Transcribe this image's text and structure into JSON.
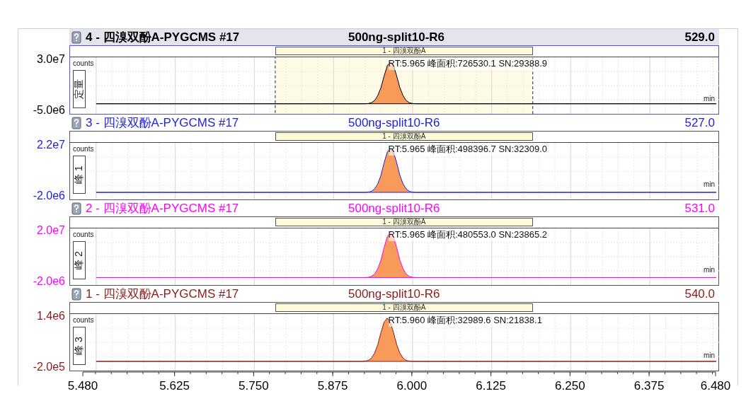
{
  "panels": [
    {
      "title": "4 - 四溴双酚A-PYGCMS #17",
      "sample": "500ng-split10-R6",
      "mass": "529.0",
      "color": "#000000",
      "selected": true,
      "bar_label": "1 - 四溴双酚A",
      "y_unit": "counts",
      "side_label": "定量",
      "peak_label": "RT:5.965 峰面积:726530.1 SN:29388.9",
      "x_unit": "min",
      "chart_data": {
        "type": "area",
        "xlim": [
          5.48,
          6.48
        ],
        "ylim": [
          -5000000,
          30000000
        ],
        "yticks": [
          {
            "value": 30000000,
            "label": "3.0e7"
          },
          {
            "value": -5000000,
            "label": "-5.0e6"
          }
        ],
        "grid": true,
        "x": [
          5.5,
          5.925,
          5.93,
          5.935,
          5.94,
          5.945,
          5.95,
          5.955,
          5.96,
          5.965,
          5.97,
          5.975,
          5.98,
          5.985,
          5.99,
          5.995,
          6.0,
          6.005,
          6.48
        ],
        "series": [
          {
            "color": "#000000",
            "values": [
              0,
              0,
              200000,
              700000,
              2200000,
              5600000,
              11000000,
              19000000,
              26000000,
              29000000,
              26000000,
              19000000,
              11000000,
              5600000,
              2200000,
              700000,
              200000,
              0,
              0
            ]
          }
        ]
      }
    },
    {
      "title": "3 - 四溴双酚A-PYGCMS #17",
      "sample": "500ng-split10-R6",
      "mass": "527.0",
      "color": "#2020e0",
      "selected": false,
      "bar_label": "1 - 四溴双酚A",
      "y_unit": "counts",
      "side_label": "峰 1",
      "peak_label": "RT:5.965 峰面积:498396.7 SN:32309.0",
      "x_unit": "min",
      "chart_data": {
        "type": "area",
        "xlim": [
          5.48,
          6.48
        ],
        "ylim": [
          -2000000,
          22000000
        ],
        "yticks": [
          {
            "value": 22000000,
            "label": "2.2e7"
          },
          {
            "value": -2000000,
            "label": "-2.0e6"
          }
        ],
        "grid": true,
        "x": [
          5.5,
          5.925,
          5.93,
          5.935,
          5.94,
          5.945,
          5.95,
          5.955,
          5.96,
          5.965,
          5.97,
          5.975,
          5.98,
          5.985,
          5.99,
          5.995,
          6.0,
          6.005,
          6.48
        ],
        "series": [
          {
            "color": "#2020e0",
            "values": [
              0,
              0,
              100000,
              500000,
              1600000,
              4000000,
              8000000,
              13900000,
              18900000,
              21000000,
              18900000,
              13900000,
              8000000,
              4000000,
              1600000,
              500000,
              100000,
              0,
              0
            ]
          }
        ]
      }
    },
    {
      "title": "2 - 四溴双酚A-PYGCMS #17",
      "sample": "500ng-split10-R6",
      "mass": "531.0",
      "color": "#ff00ff",
      "selected": false,
      "bar_label": "1 - 四溴双酚A",
      "y_unit": "counts",
      "side_label": "峰 2",
      "peak_label": "RT:5.965 峰面积:480553.0 SN:23865.2",
      "x_unit": "min",
      "chart_data": {
        "type": "area",
        "xlim": [
          5.48,
          6.48
        ],
        "ylim": [
          -2000000,
          20000000
        ],
        "yticks": [
          {
            "value": 20000000,
            "label": "2.0e7"
          },
          {
            "value": -2000000,
            "label": "-2.0e6"
          }
        ],
        "grid": true,
        "x": [
          5.5,
          5.925,
          5.93,
          5.935,
          5.94,
          5.945,
          5.95,
          5.955,
          5.96,
          5.965,
          5.97,
          5.975,
          5.98,
          5.985,
          5.99,
          5.995,
          6.0,
          6.005,
          6.48
        ],
        "series": [
          {
            "color": "#ff00ff",
            "values": [
              0,
              0,
              100000,
              500000,
              1500000,
              3800000,
              7500000,
              12900000,
              17600000,
              19500000,
              17600000,
              12900000,
              7500000,
              3800000,
              1500000,
              500000,
              100000,
              0,
              0
            ]
          }
        ]
      }
    },
    {
      "title": "1 - 四溴双酚A-PYGCMS #17",
      "sample": "500ng-split10-R6",
      "mass": "540.0",
      "color": "#8b1a1a",
      "selected": false,
      "bar_label": "1 - 四溴双酚A",
      "y_unit": "counts",
      "side_label": "峰 3",
      "peak_label": "RT:5.960 峰面积:32989.6 SN:21838.1",
      "x_unit": "min",
      "chart_data": {
        "type": "area",
        "xlim": [
          5.48,
          6.48
        ],
        "ylim": [
          -200000,
          1400000
        ],
        "yticks": [
          {
            "value": 1400000,
            "label": "1.4e6"
          },
          {
            "value": -200000,
            "label": "-2.0e5"
          }
        ],
        "grid": true,
        "x": [
          5.5,
          5.92,
          5.925,
          5.93,
          5.935,
          5.94,
          5.945,
          5.95,
          5.955,
          5.96,
          5.965,
          5.97,
          5.975,
          5.98,
          5.985,
          5.99,
          5.995,
          6.0,
          6.48
        ],
        "series": [
          {
            "color": "#8b1a1a",
            "values": [
              0,
              0,
              10000,
              30000,
              100000,
              260000,
              520000,
              900000,
              1230000,
              1360000,
              1230000,
              900000,
              520000,
              260000,
              100000,
              30000,
              10000,
              0,
              0
            ]
          }
        ],
        "xticks": [
          {
            "value": 5.48,
            "label": "5.480"
          },
          {
            "value": 5.625,
            "label": "5.625"
          },
          {
            "value": 5.75,
            "label": "5.750"
          },
          {
            "value": 5.875,
            "label": "5.875"
          },
          {
            "value": 6.0,
            "label": "6.000"
          },
          {
            "value": 6.125,
            "label": "6.125"
          },
          {
            "value": 6.25,
            "label": "6.250"
          },
          {
            "value": 6.375,
            "label": "6.375"
          },
          {
            "value": 6.48,
            "label": "6.480"
          }
        ]
      }
    }
  ]
}
